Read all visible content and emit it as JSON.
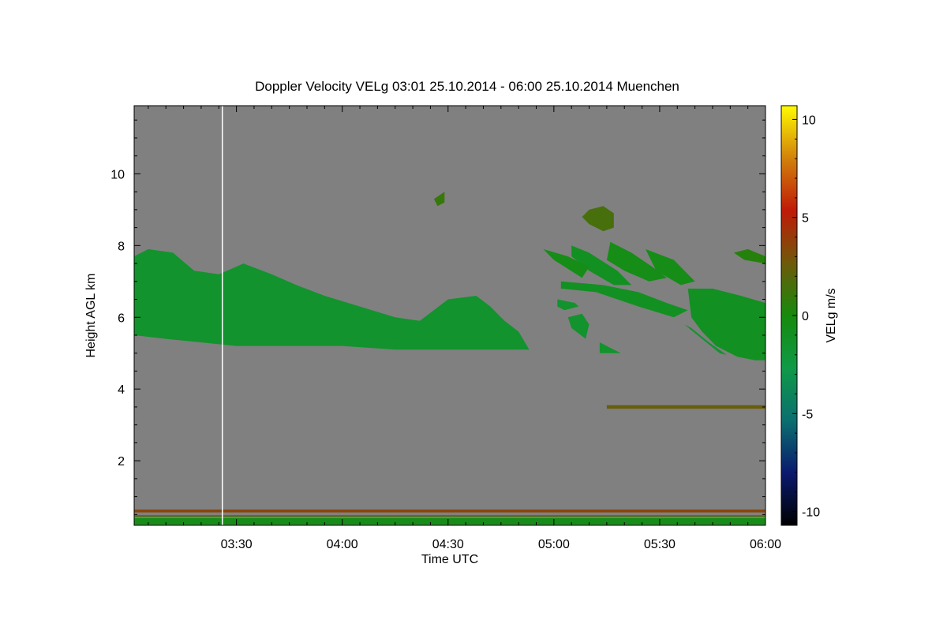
{
  "chart_data": {
    "type": "heatmap",
    "title": "Doppler Velocity VELg   03:01 25.10.2014 - 06:00 25.10.2014 Muenchen",
    "xlabel": "Time UTC",
    "ylabel": "Height AGL km",
    "colorbar_label": "VELg m/s",
    "x_range": [
      "03:01",
      "06:00"
    ],
    "x_ticks": [
      "03:30",
      "04:00",
      "04:30",
      "05:00",
      "05:30",
      "06:00"
    ],
    "ylim": [
      0.2,
      11.9
    ],
    "y_ticks": [
      2,
      4,
      6,
      8,
      10
    ],
    "colorbar_range": [
      -10.7,
      10.7
    ],
    "colorbar_ticks": [
      10,
      5,
      0,
      -5,
      -10
    ],
    "background_color": "#808080",
    "colorscale": [
      "#000000",
      "#0a1a6e",
      "#0b6f6f",
      "#0f9a47",
      "#168a0c",
      "#6e5a0a",
      "#c01a08",
      "#d2820a",
      "#fffb00"
    ],
    "features": [
      {
        "name": "main cloud layer",
        "velocity": -1.5,
        "polygon": [
          [
            "03:01",
            7.7
          ],
          [
            "03:05",
            7.9
          ],
          [
            "03:12",
            7.8
          ],
          [
            "03:18",
            7.3
          ],
          [
            "03:25",
            7.2
          ],
          [
            "03:32",
            7.5
          ],
          [
            "03:40",
            7.2
          ],
          [
            "03:47",
            6.9
          ],
          [
            "03:55",
            6.6
          ],
          [
            "04:05",
            6.3
          ],
          [
            "04:15",
            6.0
          ],
          [
            "04:22",
            5.9
          ],
          [
            "04:30",
            6.5
          ],
          [
            "04:38",
            6.6
          ],
          [
            "04:42",
            6.3
          ],
          [
            "04:46",
            5.9
          ],
          [
            "04:50",
            5.6
          ],
          [
            "04:53",
            5.1
          ],
          [
            "04:45",
            5.1
          ],
          [
            "04:30",
            5.1
          ],
          [
            "04:15",
            5.1
          ],
          [
            "04:00",
            5.2
          ],
          [
            "03:45",
            5.2
          ],
          [
            "03:30",
            5.2
          ],
          [
            "03:20",
            5.3
          ],
          [
            "03:10",
            5.4
          ],
          [
            "03:01",
            5.5
          ]
        ]
      },
      {
        "name": "upper cloud patch",
        "velocity": 1.5,
        "polygon": [
          [
            "05:08",
            8.8
          ],
          [
            "05:10",
            9.0
          ],
          [
            "05:14",
            9.1
          ],
          [
            "05:17",
            8.9
          ],
          [
            "05:17",
            8.5
          ],
          [
            "05:14",
            8.4
          ],
          [
            "05:10",
            8.6
          ]
        ]
      },
      {
        "name": "small high echo",
        "velocity": 1.0,
        "polygon": [
          [
            "04:26",
            9.3
          ],
          [
            "04:29",
            9.5
          ],
          [
            "04:29",
            9.2
          ],
          [
            "04:27",
            9.1
          ]
        ]
      },
      {
        "name": "streak A",
        "velocity": -1.0,
        "polygon": [
          [
            "05:05",
            8.0
          ],
          [
            "05:10",
            7.8
          ],
          [
            "05:18",
            7.3
          ],
          [
            "05:22",
            6.9
          ],
          [
            "05:17",
            6.9
          ],
          [
            "05:10",
            7.3
          ],
          [
            "05:05",
            7.7
          ]
        ]
      },
      {
        "name": "streak B",
        "velocity": -0.5,
        "polygon": [
          [
            "05:16",
            8.1
          ],
          [
            "05:22",
            7.8
          ],
          [
            "05:28",
            7.4
          ],
          [
            "05:32",
            7.1
          ],
          [
            "05:27",
            7.0
          ],
          [
            "05:20",
            7.3
          ],
          [
            "05:15",
            7.6
          ]
        ]
      },
      {
        "name": "streak C",
        "velocity": -0.5,
        "polygon": [
          [
            "05:26",
            7.9
          ],
          [
            "05:34",
            7.6
          ],
          [
            "05:40",
            7.0
          ],
          [
            "05:36",
            6.9
          ],
          [
            "05:29",
            7.3
          ]
        ]
      },
      {
        "name": "streak D",
        "velocity": -0.5,
        "polygon": [
          [
            "04:57",
            7.9
          ],
          [
            "05:04",
            7.7
          ],
          [
            "05:10",
            7.4
          ],
          [
            "05:08",
            7.1
          ],
          [
            "05:00",
            7.6
          ]
        ]
      },
      {
        "name": "streak E",
        "velocity": -1.0,
        "polygon": [
          [
            "05:02",
            7.0
          ],
          [
            "05:14",
            6.9
          ],
          [
            "05:24",
            6.7
          ],
          [
            "05:32",
            6.4
          ],
          [
            "05:38",
            6.2
          ],
          [
            "05:34",
            6.0
          ],
          [
            "05:24",
            6.3
          ],
          [
            "05:12",
            6.7
          ],
          [
            "05:02",
            6.8
          ]
        ]
      },
      {
        "name": "right mid cloud",
        "velocity": -1.0,
        "polygon": [
          [
            "05:38",
            6.8
          ],
          [
            "05:45",
            6.8
          ],
          [
            "05:53",
            6.6
          ],
          [
            "06:00",
            6.4
          ],
          [
            "06:00",
            4.8
          ],
          [
            "05:57",
            4.8
          ],
          [
            "05:52",
            4.9
          ],
          [
            "05:46",
            5.2
          ],
          [
            "05:42",
            5.6
          ],
          [
            "05:39",
            6.0
          ]
        ]
      },
      {
        "name": "thin diagonal",
        "velocity": -1.5,
        "polygon": [
          [
            "05:37",
            5.8
          ],
          [
            "05:42",
            5.4
          ],
          [
            "05:47",
            5.0
          ],
          [
            "05:49",
            4.95
          ],
          [
            "05:44",
            5.3
          ],
          [
            "05:39",
            5.7
          ]
        ]
      },
      {
        "name": "fragment 1",
        "velocity": -1.5,
        "polygon": [
          [
            "05:01",
            6.5
          ],
          [
            "05:06",
            6.4
          ],
          [
            "05:07",
            6.3
          ],
          [
            "05:03",
            6.2
          ],
          [
            "05:01",
            6.3
          ]
        ]
      },
      {
        "name": "fragment 2",
        "velocity": -1.5,
        "polygon": [
          [
            "05:04",
            6.0
          ],
          [
            "05:08",
            6.1
          ],
          [
            "05:10",
            5.8
          ],
          [
            "05:09",
            5.4
          ],
          [
            "05:05",
            5.7
          ]
        ]
      },
      {
        "name": "fragment 3",
        "velocity": -1.5,
        "polygon": [
          [
            "05:13",
            5.3
          ],
          [
            "05:17",
            5.1
          ],
          [
            "05:19",
            5.0
          ],
          [
            "05:13",
            5.0
          ]
        ]
      },
      {
        "name": "upper right patch",
        "velocity": 0.5,
        "polygon": [
          [
            "05:51",
            7.8
          ],
          [
            "05:55",
            7.9
          ],
          [
            "06:00",
            7.7
          ],
          [
            "06:00",
            7.5
          ],
          [
            "05:54",
            7.6
          ]
        ]
      },
      {
        "name": "band 0.60 km",
        "velocity": 3.5,
        "polygon": [
          [
            "03:01",
            0.64
          ],
          [
            "06:00",
            0.64
          ],
          [
            "06:00",
            0.56
          ],
          [
            "03:01",
            0.56
          ]
        ]
      },
      {
        "name": "band 0.50 km",
        "velocity": 1.5,
        "polygon": [
          [
            "03:01",
            0.48
          ],
          [
            "06:00",
            0.48
          ],
          [
            "06:00",
            0.44
          ],
          [
            "03:01",
            0.44
          ]
        ]
      },
      {
        "name": "band 0.35 km",
        "velocity": -0.5,
        "polygon": [
          [
            "03:01",
            0.4
          ],
          [
            "06:00",
            0.4
          ],
          [
            "06:00",
            0.22
          ],
          [
            "03:01",
            0.22
          ]
        ]
      },
      {
        "name": "aerosol band 3.5 km",
        "velocity": 2.5,
        "polygon": [
          [
            "05:15",
            3.55
          ],
          [
            "06:00",
            3.55
          ],
          [
            "06:00",
            3.45
          ],
          [
            "05:15",
            3.45
          ]
        ]
      }
    ],
    "vertical_line_at": "03:26",
    "grid": false
  }
}
